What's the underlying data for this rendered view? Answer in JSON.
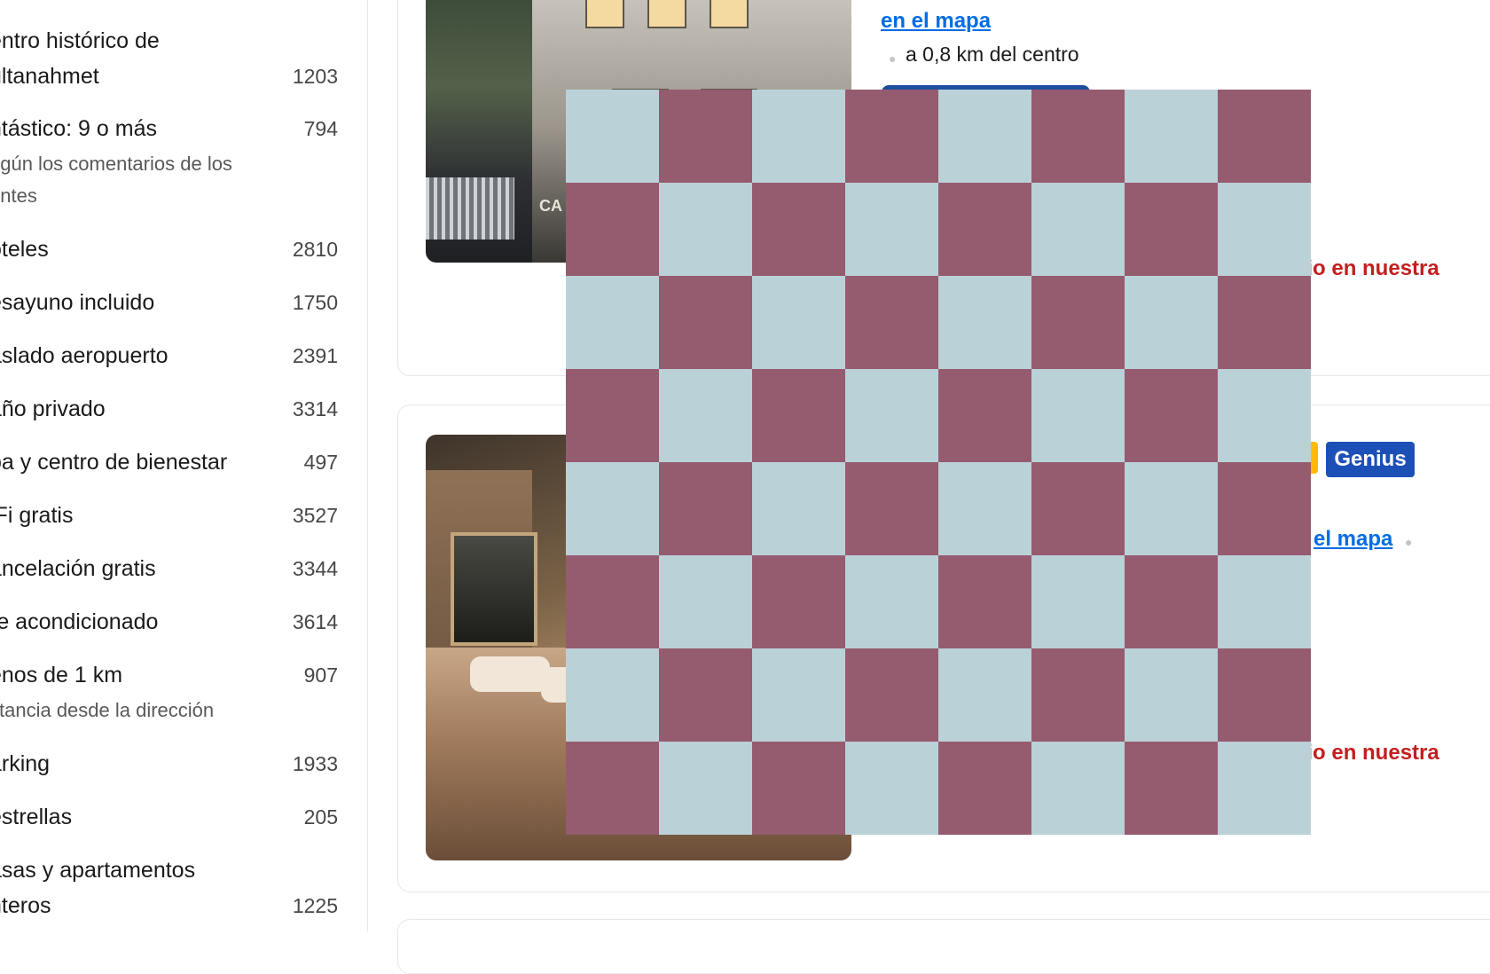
{
  "sidebar": {
    "filters": [
      {
        "label": "entro histórico de",
        "label2": "ultanahmet",
        "count": "1203"
      },
      {
        "label": "ntástico: 9 o más",
        "count": "794",
        "sub": [
          "egún los comentarios de los",
          "entes"
        ]
      },
      {
        "label": "oteles",
        "count": "2810"
      },
      {
        "label": "esayuno incluido",
        "count": "1750"
      },
      {
        "label": "aslado aeropuerto",
        "count": "2391"
      },
      {
        "label": "año privado",
        "count": "3314"
      },
      {
        "label": "pa y centro de bienestar",
        "count": "497"
      },
      {
        "label": "iFi gratis",
        "count": "3527"
      },
      {
        "label": "ancelación gratis",
        "count": "3344"
      },
      {
        "label": "re acondicionado",
        "count": "3614"
      },
      {
        "label": "enos de 1 km",
        "count": "907",
        "sub": [
          "stancia desde la dirección"
        ]
      },
      {
        "label": "arking",
        "count": "1933"
      },
      {
        "label": "estrellas",
        "count": "205"
      },
      {
        "label": "asas y apartamentos",
        "label2": "nteros",
        "count": "1225"
      }
    ]
  },
  "listing1": {
    "map_link": "en el mapa",
    "distance": "a 0,8 km del centro",
    "photo_sign": "CA",
    "promo": "cio en nuestra"
  },
  "listing2": {
    "genius": "Genius",
    "map_link": "el mapa",
    "promo": "cio en nuestra"
  },
  "overlay": {
    "colors": {
      "dark": "#955b6f",
      "light": "#bbd1d8"
    }
  }
}
